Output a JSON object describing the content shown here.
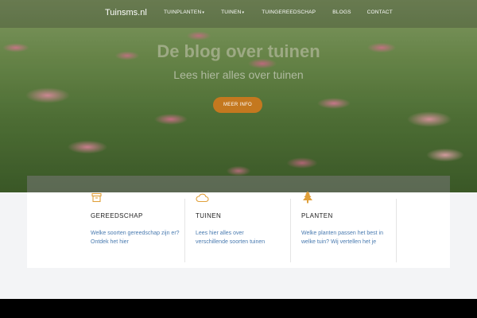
{
  "header": {
    "logo": "Tuinsms.nl",
    "nav": [
      {
        "label": "TUINPLANTEN",
        "has_dropdown": true
      },
      {
        "label": "TUINEN",
        "has_dropdown": true
      },
      {
        "label": "TUINGEREEDSCHAP",
        "has_dropdown": false
      },
      {
        "label": "BLOGS",
        "has_dropdown": false
      },
      {
        "label": "CONTACT",
        "has_dropdown": false
      }
    ]
  },
  "hero": {
    "title": "De blog over tuinen",
    "subtitle": "Lees hier alles over tuinen",
    "button_label": "MEER INFO"
  },
  "cards": [
    {
      "icon": "archive-box-icon",
      "title": "GEREEDSCHAP",
      "text": "Welke soorten gereedschap zijn er? Ontdek het hier"
    },
    {
      "icon": "cloud-icon",
      "title": "TUINEN",
      "text": "Lees hier alles over verschillende soorten tuinen"
    },
    {
      "icon": "tree-icon",
      "title": "PLANTEN",
      "text": "Welke planten passen het best in welke tuin? Wij vertellen het je"
    }
  ],
  "colors": {
    "accent": "#c4781f",
    "link": "#4a7bb0",
    "footer": "#000000"
  }
}
